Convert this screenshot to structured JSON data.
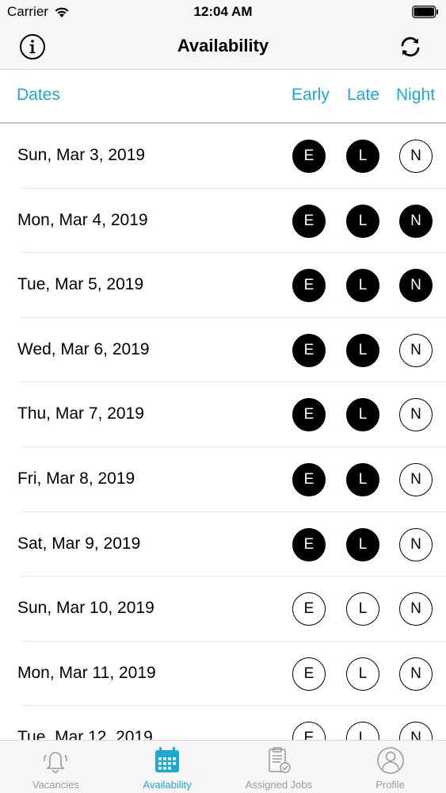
{
  "status_bar": {
    "carrier": "Carrier",
    "time": "12:04 AM"
  },
  "nav": {
    "title": "Availability",
    "info_icon": "info-icon",
    "refresh_icon": "refresh-icon"
  },
  "columns": {
    "dates": "Dates",
    "early": "Early",
    "late": "Late",
    "night": "Night"
  },
  "shift_letters": {
    "early": "E",
    "late": "L",
    "night": "N"
  },
  "rows": [
    {
      "date": "Sun, Mar 3, 2019",
      "early": true,
      "late": true,
      "night": false
    },
    {
      "date": "Mon, Mar 4, 2019",
      "early": true,
      "late": true,
      "night": true
    },
    {
      "date": "Tue, Mar 5, 2019",
      "early": true,
      "late": true,
      "night": true
    },
    {
      "date": "Wed, Mar 6, 2019",
      "early": true,
      "late": true,
      "night": false
    },
    {
      "date": "Thu, Mar 7, 2019",
      "early": true,
      "late": true,
      "night": false
    },
    {
      "date": "Fri, Mar 8, 2019",
      "early": true,
      "late": true,
      "night": false
    },
    {
      "date": "Sat, Mar 9, 2019",
      "early": true,
      "late": true,
      "night": false
    },
    {
      "date": "Sun, Mar 10, 2019",
      "early": false,
      "late": false,
      "night": false
    },
    {
      "date": "Mon, Mar 11, 2019",
      "early": false,
      "late": false,
      "night": false
    },
    {
      "date": "Tue, Mar 12, 2019",
      "early": false,
      "late": false,
      "night": false
    }
  ],
  "tabs": [
    {
      "label": "Vacancies",
      "icon": "bell-icon",
      "active": false
    },
    {
      "label": "Availability",
      "icon": "calendar-icon",
      "active": true
    },
    {
      "label": "Assigned Jobs",
      "icon": "clipboard-check-icon",
      "active": false
    },
    {
      "label": "Profile",
      "icon": "user-circle-icon",
      "active": false
    }
  ],
  "colors": {
    "accent": "#1aa9d6",
    "selected": "#000000",
    "inactive_tab": "#9a9a9a"
  }
}
